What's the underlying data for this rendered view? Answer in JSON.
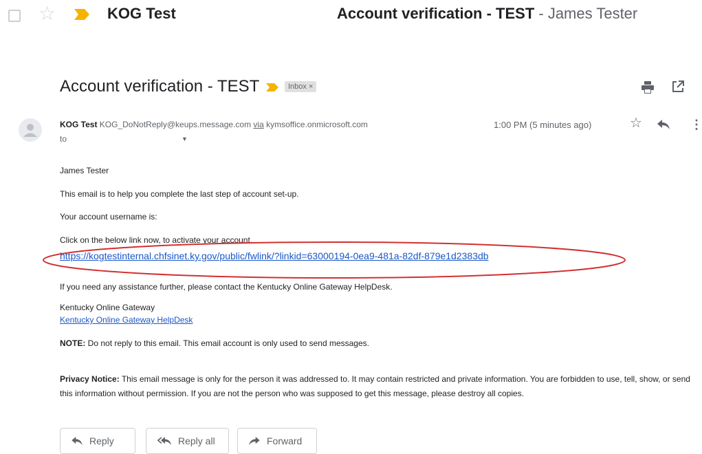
{
  "thread_row": {
    "sender": "KOG Test",
    "subject": "Account verification - TEST",
    "snippet": " - James Tester"
  },
  "message": {
    "subject": "Account verification - TEST",
    "label": "Inbox ×",
    "from_name": "KOG Test",
    "from_email": "KOG_DoNotReply@keups.message.com",
    "via_word": "via",
    "via_domain": "kymsoffice.onmicrosoft.com",
    "to": "to",
    "time": "1:00 PM (5 minutes ago)"
  },
  "body": {
    "greeting": "James Tester",
    "line1": "This email is to help you complete the last step of account set-up.",
    "line2": "Your account username is:",
    "line3": "Click on the below link now, to activate your account.",
    "link": "https://kogtestinternal.chfsinet.ky.gov/public/fwlink/?linkid=63000194-0ea9-481a-82df-879e1d2383db",
    "line4": "If you need any assistance further, please contact the Kentucky Online Gateway HelpDesk.",
    "sig_name": "Kentucky Online Gateway",
    "sig_link": "Kentucky Online Gateway HelpDesk",
    "note_label": "NOTE:",
    "note_text": " Do not reply to this email. This email account is only used to send messages.",
    "privacy_label": "Privacy Notice:",
    "privacy_text": " This email message is only for the person it was addressed to. It may contain restricted and private information. You are forbidden to use, tell, show, or send this information without permission. If you are not the person who was supposed to get this message, please destroy all copies."
  },
  "actions": {
    "reply": "Reply",
    "reply_all": "Reply all",
    "forward": "Forward"
  },
  "colors": {
    "link": "#1a57c8",
    "important": "#f4b400",
    "annotation": "#d32f2f"
  }
}
